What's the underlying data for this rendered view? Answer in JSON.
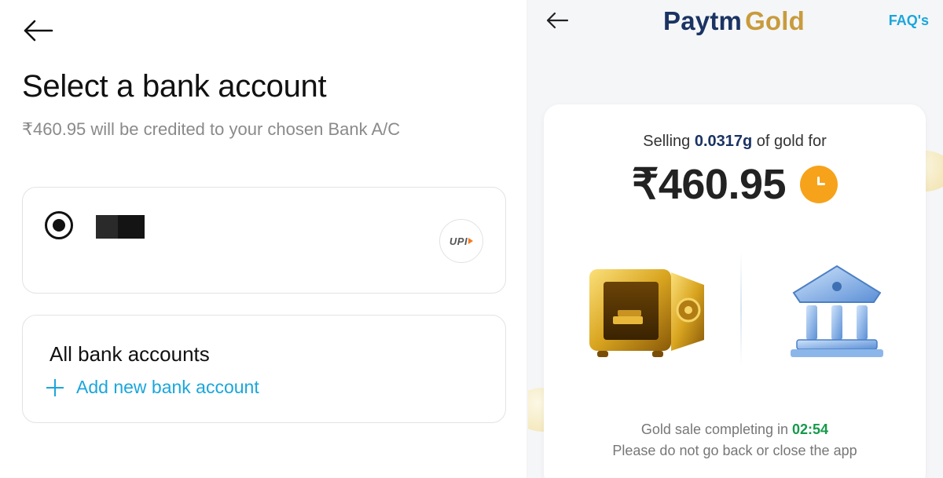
{
  "left_screen": {
    "title": "Select a bank account",
    "subtitle": "₹460.95 will be credited to your chosen Bank A/C",
    "selected_bank": {
      "upi_badge": "UPI"
    },
    "all_accounts": {
      "title": "All bank accounts",
      "add_label": "Add new bank account"
    }
  },
  "right_screen": {
    "brand": {
      "paytm": "Paytm",
      "gold": "Gold"
    },
    "faq_label": "FAQ's",
    "sell": {
      "prefix": "Selling",
      "grams": "0.0317g",
      "suffix": "of gold for"
    },
    "amount": "₹460.95",
    "sale_status": {
      "prefix": "Gold sale completing in",
      "timer": "02:54"
    },
    "warning": "Please do not go back or close the app"
  },
  "colors": {
    "accent_blue": "#1aa6dc",
    "paytm_navy": "#1a3363",
    "gold": "#c89b3c",
    "timer_orange": "#f7a21b",
    "timer_green": "#159a4a"
  },
  "icons": [
    "back-arrow-icon",
    "radio-selected-icon",
    "upi-icon",
    "plus-icon",
    "timer-icon",
    "gold-vault-icon",
    "bank-building-icon"
  ]
}
